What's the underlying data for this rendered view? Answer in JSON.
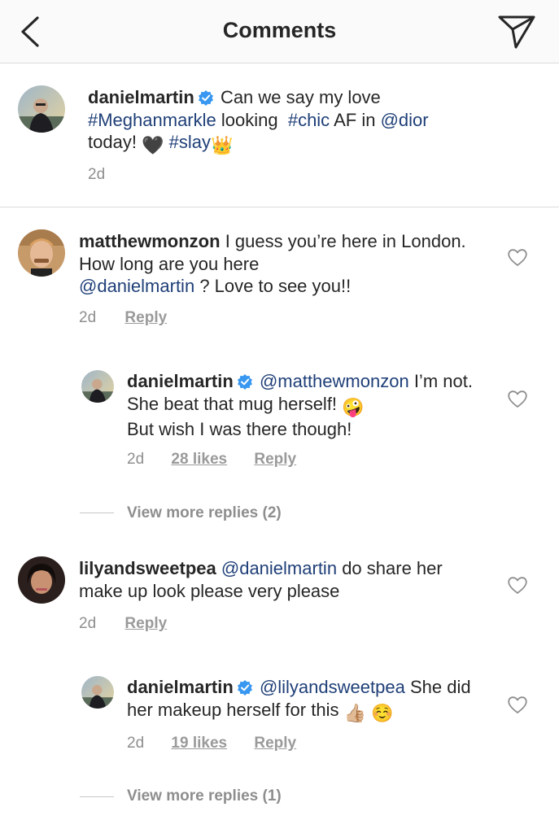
{
  "header": {
    "title": "Comments",
    "back_icon": "chevron-left-icon",
    "share_icon": "paper-plane-icon"
  },
  "post": {
    "username": "danielmartin",
    "verified": true,
    "caption_parts": [
      "Can we say my love",
      "#Meghanmarkle",
      "looking",
      "#chic",
      "AF in",
      "@dior",
      "today!",
      "🖤",
      "#slay",
      "👑"
    ],
    "time": "2d"
  },
  "comments": [
    {
      "username": "matthewmonzon",
      "text_parts": [
        "I guess you’re here in London.  How long are you here",
        "@danielmartin",
        "?  Love to see you!!"
      ],
      "time": "2d",
      "reply_label": "Reply",
      "replies": [
        {
          "username": "danielmartin",
          "verified": true,
          "text_parts": [
            "@matthewmonzon",
            "I’m not. She beat that mug herself!",
            "🤪",
            "But wish I was there though!"
          ],
          "time": "2d",
          "likes": "28 likes",
          "reply_label": "Reply"
        }
      ],
      "view_more": "View more replies (2)"
    },
    {
      "username": "lilyandsweetpea",
      "text_parts": [
        "@danielmartin",
        "do share her make up look please very please"
      ],
      "time": "2d",
      "reply_label": "Reply",
      "replies": [
        {
          "username": "danielmartin",
          "verified": true,
          "text_parts": [
            "@lilyandsweetpea",
            "She did her makeup herself for this",
            "👍🏼",
            "☺️"
          ],
          "time": "2d",
          "likes": "19 likes",
          "reply_label": "Reply"
        }
      ],
      "view_more": "View more replies (1)"
    }
  ],
  "colors": {
    "link": "#1f3f78",
    "muted": "#8e8e8e",
    "verified": "#3897f0",
    "divider": "#dbdbdb"
  },
  "icons": {
    "verified": "verified-badge-icon",
    "heart": "heart-outline-icon"
  }
}
